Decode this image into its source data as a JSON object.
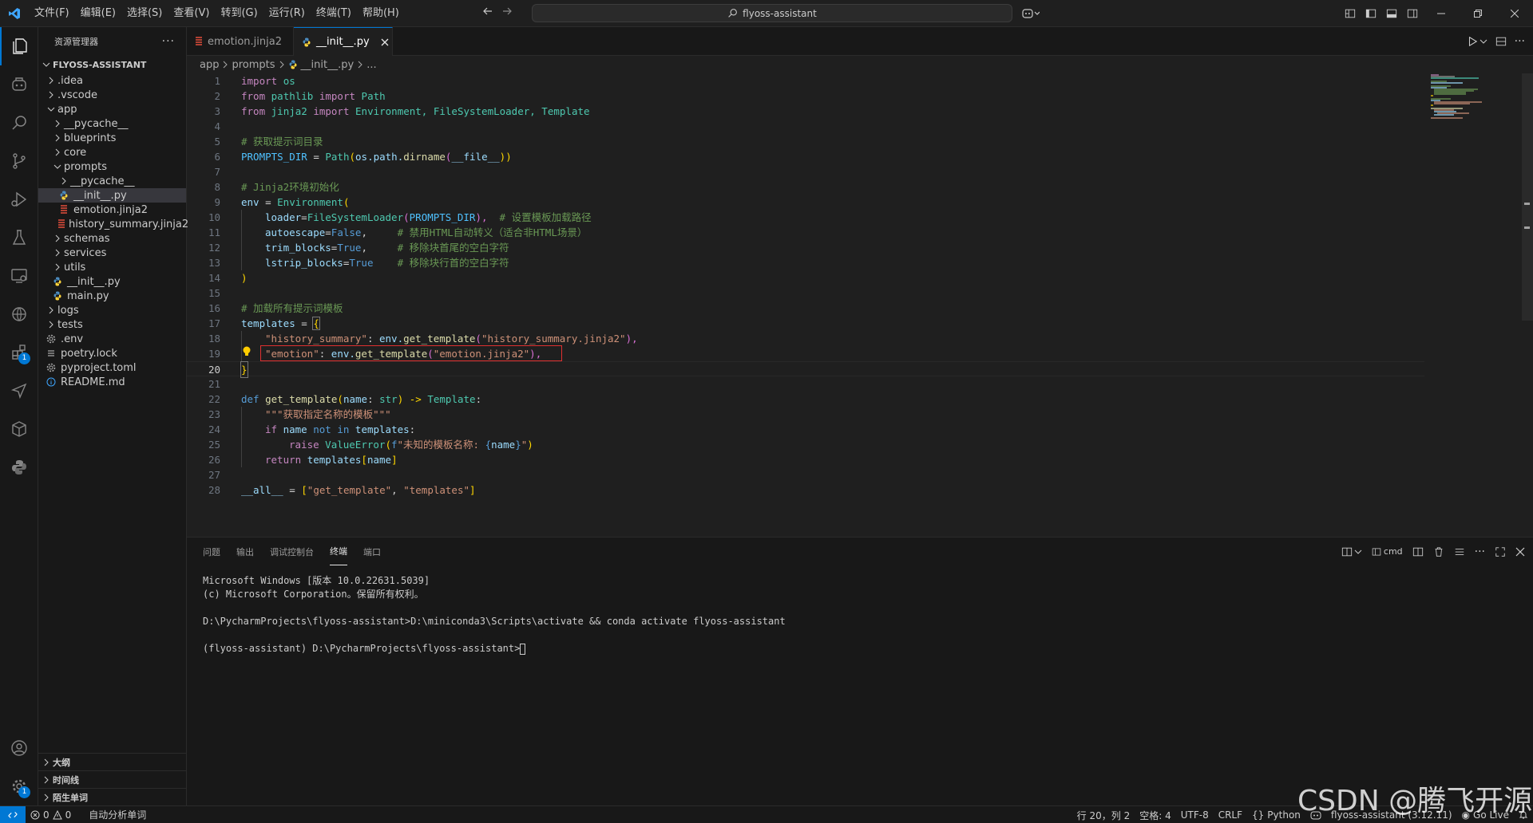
{
  "menu": [
    "文件(F)",
    "编辑(E)",
    "选择(S)",
    "查看(V)",
    "转到(G)",
    "运行(R)",
    "终端(T)",
    "帮助(H)"
  ],
  "command_center": "flyoss-assistant",
  "sidebar": {
    "title": "资源管理器",
    "root": "FLYOSS-ASSISTANT",
    "tree": [
      {
        "label": ".idea",
        "type": "folder"
      },
      {
        "label": ".vscode",
        "type": "folder"
      },
      {
        "label": "app",
        "type": "folder-open"
      },
      {
        "label": "__pycache__",
        "type": "folder"
      },
      {
        "label": "blueprints",
        "type": "folder"
      },
      {
        "label": "core",
        "type": "folder"
      },
      {
        "label": "prompts",
        "type": "folder-open"
      },
      {
        "label": "__pycache__",
        "type": "folder"
      },
      {
        "label": "__init__.py",
        "type": "python"
      },
      {
        "label": "emotion.jinja2",
        "type": "jinja"
      },
      {
        "label": "history_summary.jinja2",
        "type": "jinja"
      },
      {
        "label": "schemas",
        "type": "folder"
      },
      {
        "label": "services",
        "type": "folder"
      },
      {
        "label": "utils",
        "type": "folder"
      },
      {
        "label": "__init__.py",
        "type": "python"
      },
      {
        "label": "main.py",
        "type": "python"
      },
      {
        "label": "logs",
        "type": "folder"
      },
      {
        "label": "tests",
        "type": "folder"
      },
      {
        "label": ".env",
        "type": "gear"
      },
      {
        "label": "poetry.lock",
        "type": "lines"
      },
      {
        "label": "pyproject.toml",
        "type": "gear"
      },
      {
        "label": "README.md",
        "type": "info"
      }
    ],
    "sections": [
      "大纲",
      "时间线",
      "陌生单词"
    ]
  },
  "tabs": [
    {
      "label": "emotion.jinja2",
      "active": false
    },
    {
      "label": "__init__.py",
      "active": true
    }
  ],
  "breadcrumb": [
    "app",
    "prompts",
    "__init__.py",
    "..."
  ],
  "code_lines": [
    "1",
    "2",
    "3",
    "4",
    "5",
    "6",
    "7",
    "8",
    "9",
    "10",
    "11",
    "12",
    "13",
    "14",
    "15",
    "16",
    "17",
    "18",
    "19",
    "20",
    "21",
    "22",
    "23",
    "24",
    "25",
    "26",
    "27",
    "28"
  ],
  "code": {
    "l1_kw": "import",
    "l1_mod": "os",
    "l2_kw": "from",
    "l2_mod": "pathlib",
    "l2_kw2": "import",
    "l2_cls": "Path",
    "l3_kw": "from",
    "l3_mod": "jinja2",
    "l3_kw2": "import",
    "l3_rest": "Environment, FileSystemLoader, Template",
    "l5": "# 获取提示词目录",
    "l6_var": "PROMPTS_DIR",
    "l6_eq": " = ",
    "l6_cls": "Path",
    "l6_a": "(",
    "l6_b": "os.path.",
    "l6_fn": "dirname",
    "l6_c": "(",
    "l6_d": "__file__",
    "l6_e": "))",
    "l8": "# Jinja2环境初始化",
    "l9_var": "env",
    "l9_eq": " = ",
    "l9_cls": "Environment",
    "l9_p": "(",
    "l10_var": "loader",
    "l10_eq": "=",
    "l10_cls": "FileSystemLoader",
    "l10_a": "(",
    "l10_b": "PROMPTS_DIR",
    "l10_c": "),",
    "l10_cm": "  # 设置模板加载路径",
    "l11_var": "autoescape",
    "l11_eq": "=",
    "l11_val": "False",
    "l11_c": ",",
    "l11_cm": "     # 禁用HTML自动转义（适合非HTML场景）",
    "l12_var": "trim_blocks",
    "l12_eq": "=",
    "l12_val": "True",
    "l12_c": ",",
    "l12_cm": "     # 移除块首尾的空白字符",
    "l13_var": "lstrip_blocks",
    "l13_eq": "=",
    "l13_val": "True",
    "l13_cm": "    # 移除块行首的空白字符",
    "l14": ")",
    "l16": "# 加载所有提示词模板",
    "l17_var": "templates",
    "l17_eq": " = ",
    "l17_p": "{",
    "l18_key": "\"history_summary\"",
    "l18_a": ": ",
    "l18_b": "env.",
    "l18_fn": "get_template",
    "l18_c": "(",
    "l18_s": "\"history_summary.jinja2\"",
    "l18_d": "),",
    "l19_key": "\"emotion\"",
    "l19_a": ": ",
    "l19_b": "env.",
    "l19_fn": "get_template",
    "l19_c": "(",
    "l19_s": "\"emotion.jinja2\"",
    "l19_d": "),",
    "l20": "}",
    "l22_kw": "def",
    "l22_fn": "get_template",
    "l22_a": "(",
    "l22_var": "name",
    "l22_b": ": ",
    "l22_cls": "str",
    "l22_c": ") -> ",
    "l22_cls2": "Template",
    "l22_d": ":",
    "l23": "\"\"\"获取指定名称的模板\"\"\"",
    "l24_kw": "if",
    "l24_var": "name",
    "l24_kw2": "not in",
    "l24_var2": "templates",
    "l24_c": ":",
    "l25_kw": "raise",
    "l25_cls": "ValueError",
    "l25_a": "(",
    "l25_f": "f",
    "l25_s1": "\"未知的模板名称: ",
    "l25_b": "{",
    "l25_var": "name",
    "l25_c": "}",
    "l25_s2": "\"",
    "l25_d": ")",
    "l26_kw": "return",
    "l26_var": "templates",
    "l26_a": "[",
    "l26_var2": "name",
    "l26_b": "]",
    "l28_var": "__all__",
    "l28_eq": " = ",
    "l28_a": "[",
    "l28_s1": "\"get_template\"",
    "l28_c": ", ",
    "l28_s2": "\"templates\"",
    "l28_b": "]"
  },
  "panel": {
    "tabs": [
      "问题",
      "输出",
      "调试控制台",
      "终端",
      "端口"
    ],
    "active_tab": "终端",
    "terminal_profile": "cmd",
    "terminal_lines": [
      "Microsoft Windows [版本 10.0.22631.5039]",
      "(c) Microsoft Corporation。保留所有权利。",
      "",
      "D:\\PycharmProjects\\flyoss-assistant>D:\\miniconda3\\Scripts\\activate && conda activate flyoss-assistant",
      "",
      "(flyoss-assistant) D:\\PycharmProjects\\flyoss-assistant>"
    ]
  },
  "status": {
    "errors": "0",
    "warnings": "0",
    "left_extra": "自动分析单词",
    "position": "行 20，列 2",
    "spaces": "空格: 4",
    "encoding": "UTF-8",
    "eol": "CRLF",
    "language": "Python",
    "interpreter": "flyoss-assistant (3.12.11)",
    "golive": "Go Live"
  },
  "activity_badges": {
    "extensions": "1",
    "settings": "1"
  },
  "watermark": "CSDN @腾飞开源",
  "colors": {
    "accent": "#0078d4",
    "highlight_box": "#e03030"
  }
}
